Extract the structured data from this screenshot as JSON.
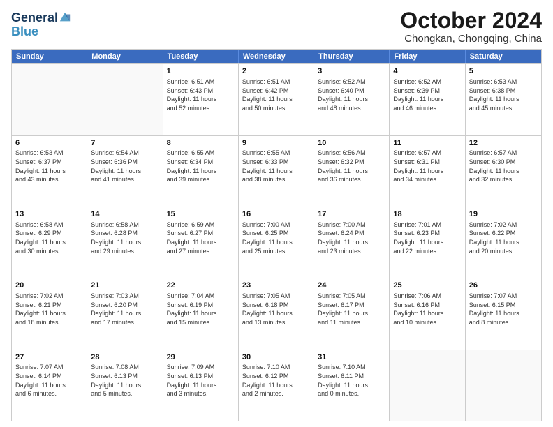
{
  "logo": {
    "line1": "General",
    "line2": "Blue"
  },
  "title": "October 2024",
  "location": "Chongkan, Chongqing, China",
  "days_of_week": [
    "Sunday",
    "Monday",
    "Tuesday",
    "Wednesday",
    "Thursday",
    "Friday",
    "Saturday"
  ],
  "weeks": [
    [
      {
        "day": "",
        "info": ""
      },
      {
        "day": "",
        "info": ""
      },
      {
        "day": "1",
        "info": "Sunrise: 6:51 AM\nSunset: 6:43 PM\nDaylight: 11 hours\nand 52 minutes."
      },
      {
        "day": "2",
        "info": "Sunrise: 6:51 AM\nSunset: 6:42 PM\nDaylight: 11 hours\nand 50 minutes."
      },
      {
        "day": "3",
        "info": "Sunrise: 6:52 AM\nSunset: 6:40 PM\nDaylight: 11 hours\nand 48 minutes."
      },
      {
        "day": "4",
        "info": "Sunrise: 6:52 AM\nSunset: 6:39 PM\nDaylight: 11 hours\nand 46 minutes."
      },
      {
        "day": "5",
        "info": "Sunrise: 6:53 AM\nSunset: 6:38 PM\nDaylight: 11 hours\nand 45 minutes."
      }
    ],
    [
      {
        "day": "6",
        "info": "Sunrise: 6:53 AM\nSunset: 6:37 PM\nDaylight: 11 hours\nand 43 minutes."
      },
      {
        "day": "7",
        "info": "Sunrise: 6:54 AM\nSunset: 6:36 PM\nDaylight: 11 hours\nand 41 minutes."
      },
      {
        "day": "8",
        "info": "Sunrise: 6:55 AM\nSunset: 6:34 PM\nDaylight: 11 hours\nand 39 minutes."
      },
      {
        "day": "9",
        "info": "Sunrise: 6:55 AM\nSunset: 6:33 PM\nDaylight: 11 hours\nand 38 minutes."
      },
      {
        "day": "10",
        "info": "Sunrise: 6:56 AM\nSunset: 6:32 PM\nDaylight: 11 hours\nand 36 minutes."
      },
      {
        "day": "11",
        "info": "Sunrise: 6:57 AM\nSunset: 6:31 PM\nDaylight: 11 hours\nand 34 minutes."
      },
      {
        "day": "12",
        "info": "Sunrise: 6:57 AM\nSunset: 6:30 PM\nDaylight: 11 hours\nand 32 minutes."
      }
    ],
    [
      {
        "day": "13",
        "info": "Sunrise: 6:58 AM\nSunset: 6:29 PM\nDaylight: 11 hours\nand 30 minutes."
      },
      {
        "day": "14",
        "info": "Sunrise: 6:58 AM\nSunset: 6:28 PM\nDaylight: 11 hours\nand 29 minutes."
      },
      {
        "day": "15",
        "info": "Sunrise: 6:59 AM\nSunset: 6:27 PM\nDaylight: 11 hours\nand 27 minutes."
      },
      {
        "day": "16",
        "info": "Sunrise: 7:00 AM\nSunset: 6:25 PM\nDaylight: 11 hours\nand 25 minutes."
      },
      {
        "day": "17",
        "info": "Sunrise: 7:00 AM\nSunset: 6:24 PM\nDaylight: 11 hours\nand 23 minutes."
      },
      {
        "day": "18",
        "info": "Sunrise: 7:01 AM\nSunset: 6:23 PM\nDaylight: 11 hours\nand 22 minutes."
      },
      {
        "day": "19",
        "info": "Sunrise: 7:02 AM\nSunset: 6:22 PM\nDaylight: 11 hours\nand 20 minutes."
      }
    ],
    [
      {
        "day": "20",
        "info": "Sunrise: 7:02 AM\nSunset: 6:21 PM\nDaylight: 11 hours\nand 18 minutes."
      },
      {
        "day": "21",
        "info": "Sunrise: 7:03 AM\nSunset: 6:20 PM\nDaylight: 11 hours\nand 17 minutes."
      },
      {
        "day": "22",
        "info": "Sunrise: 7:04 AM\nSunset: 6:19 PM\nDaylight: 11 hours\nand 15 minutes."
      },
      {
        "day": "23",
        "info": "Sunrise: 7:05 AM\nSunset: 6:18 PM\nDaylight: 11 hours\nand 13 minutes."
      },
      {
        "day": "24",
        "info": "Sunrise: 7:05 AM\nSunset: 6:17 PM\nDaylight: 11 hours\nand 11 minutes."
      },
      {
        "day": "25",
        "info": "Sunrise: 7:06 AM\nSunset: 6:16 PM\nDaylight: 11 hours\nand 10 minutes."
      },
      {
        "day": "26",
        "info": "Sunrise: 7:07 AM\nSunset: 6:15 PM\nDaylight: 11 hours\nand 8 minutes."
      }
    ],
    [
      {
        "day": "27",
        "info": "Sunrise: 7:07 AM\nSunset: 6:14 PM\nDaylight: 11 hours\nand 6 minutes."
      },
      {
        "day": "28",
        "info": "Sunrise: 7:08 AM\nSunset: 6:13 PM\nDaylight: 11 hours\nand 5 minutes."
      },
      {
        "day": "29",
        "info": "Sunrise: 7:09 AM\nSunset: 6:13 PM\nDaylight: 11 hours\nand 3 minutes."
      },
      {
        "day": "30",
        "info": "Sunrise: 7:10 AM\nSunset: 6:12 PM\nDaylight: 11 hours\nand 2 minutes."
      },
      {
        "day": "31",
        "info": "Sunrise: 7:10 AM\nSunset: 6:11 PM\nDaylight: 11 hours\nand 0 minutes."
      },
      {
        "day": "",
        "info": ""
      },
      {
        "day": "",
        "info": ""
      }
    ]
  ]
}
